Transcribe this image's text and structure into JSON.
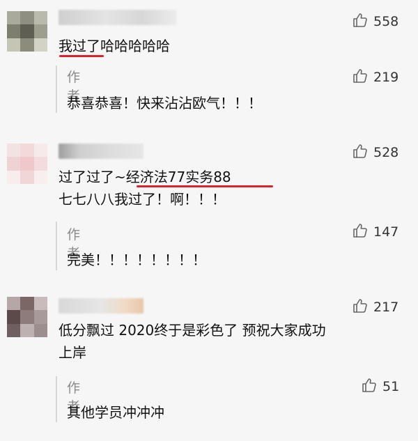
{
  "comments": [
    {
      "likes": "558",
      "text_lines": [
        "我过了哈哈哈哈哈"
      ],
      "reply": {
        "author_label": "作者",
        "likes": "219",
        "text": "恭喜恭喜！快来沾沾欧气！！！"
      }
    },
    {
      "likes": "528",
      "text_lines": [
        "过了过了~经济法77实务88",
        "七七八八我过了！啊！！！"
      ],
      "reply": {
        "author_label": "作者",
        "likes": "147",
        "text": "完美！！！！！！！！"
      }
    },
    {
      "likes": "217",
      "text_lines": [
        "低分飘过 2020终于是彩色了 预祝大家成功",
        "上岸"
      ],
      "reply": {
        "author_label": "作者",
        "likes": "51",
        "text": "其他学员冲冲冲"
      }
    }
  ],
  "icons": {
    "like": "thumbs-up-icon"
  },
  "colors": {
    "highlight_underline": "#e0202a",
    "background": "#f6f6f6"
  }
}
